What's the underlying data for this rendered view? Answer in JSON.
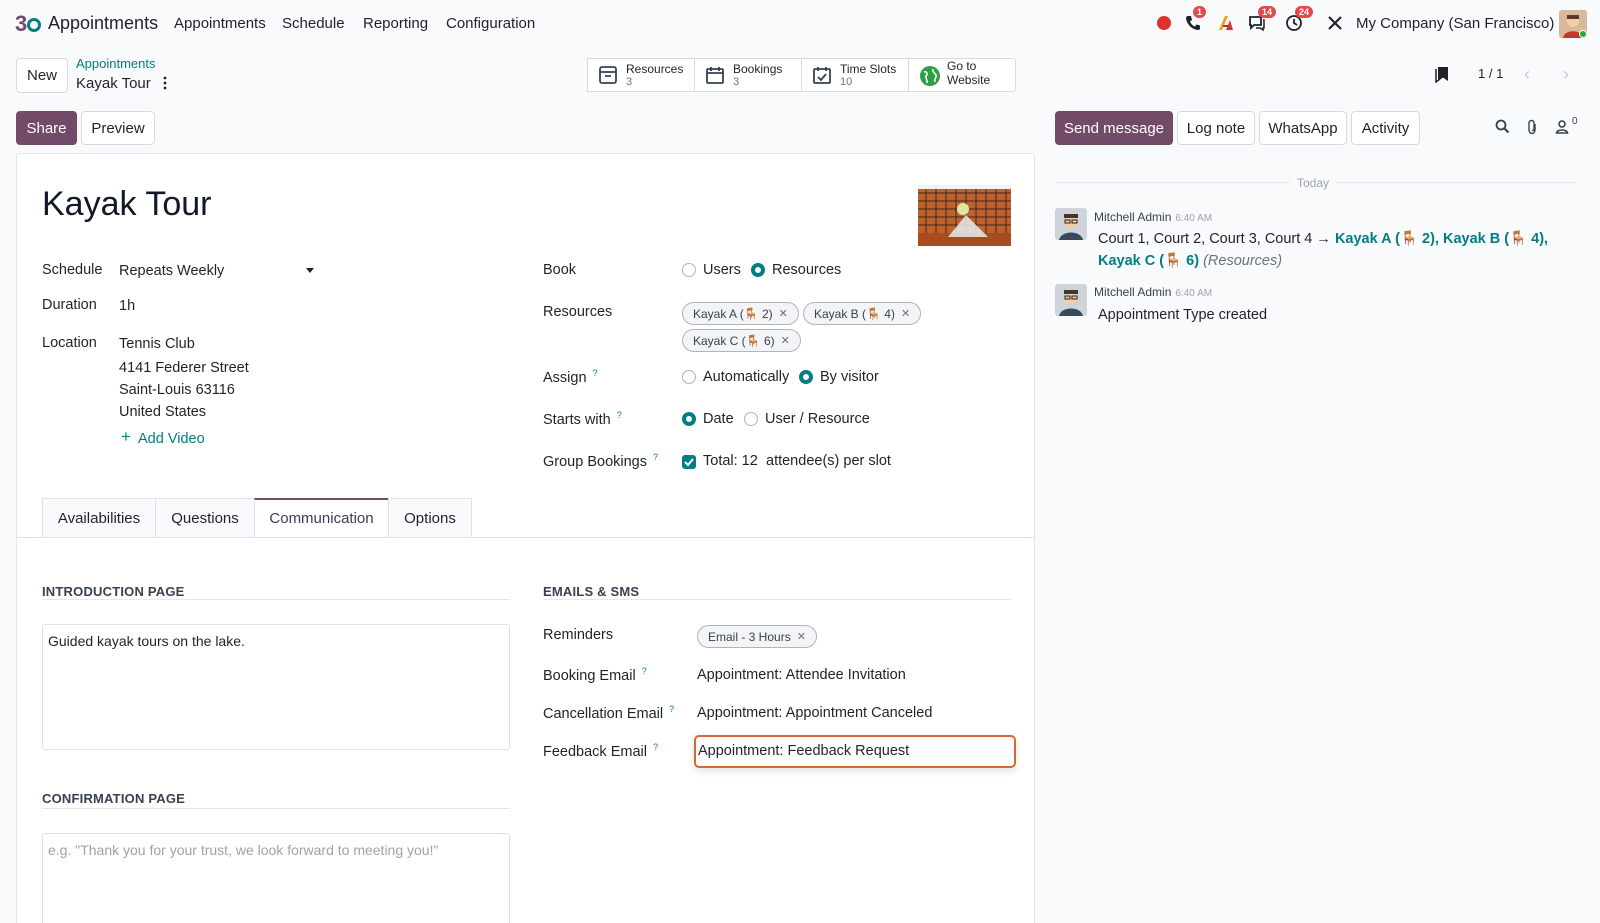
{
  "nav": {
    "app_name": "Appointments",
    "menu": [
      "Appointments",
      "Schedule",
      "Reporting",
      "Configuration"
    ],
    "badges": {
      "phone": "1",
      "chat": "14",
      "activity": "24"
    },
    "company": "My Company (San Francisco)"
  },
  "control": {
    "new_label": "New",
    "breadcrumb_parent": "Appointments",
    "breadcrumb_current": "Kayak Tour",
    "pager": "1 / 1",
    "smart_buttons": [
      {
        "label": "Resources",
        "count": "3",
        "icon": "resources-icon"
      },
      {
        "label": "Bookings",
        "count": "3",
        "icon": "calendar-icon"
      },
      {
        "label": "Time Slots",
        "count": "10",
        "icon": "calendar-check-icon"
      },
      {
        "label": "Go to",
        "count": "Website",
        "icon": "globe-icon"
      }
    ]
  },
  "actions": {
    "share": "Share",
    "preview": "Preview"
  },
  "form": {
    "title": "Kayak Tour",
    "schedule_label": "Schedule",
    "schedule_value": "Repeats Weekly",
    "duration_label": "Duration",
    "duration_value": "1h",
    "location_label": "Location",
    "location_lines": [
      "Tennis Club",
      "4141 Federer Street",
      "Saint-Louis 63116",
      "United States"
    ],
    "add_video": "Add Video",
    "book_label": "Book",
    "book_options": [
      "Users",
      "Resources"
    ],
    "resources_label": "Resources",
    "resources_tags": [
      "Kayak A (🪑 2)",
      "Kayak B (🪑 4)",
      "Kayak C (🪑 6)"
    ],
    "assign_label": "Assign",
    "assign_options": [
      "Automatically",
      "By visitor"
    ],
    "starts_label": "Starts with",
    "starts_options": [
      "Date",
      "User / Resource"
    ],
    "group_label": "Group Bookings",
    "group_total": "Total: 12",
    "group_suffix": "attendee(s) per slot"
  },
  "tabs": [
    "Availabilities",
    "Questions",
    "Communication",
    "Options"
  ],
  "communication": {
    "intro_title": "INTRODUCTION PAGE",
    "intro_text": "Guided kayak tours on the lake.",
    "confirm_title": "CONFIRMATION PAGE",
    "confirm_placeholder": "e.g. \"Thank you for your trust, we look forward to meeting you!\"",
    "emails_title": "EMAILS & SMS",
    "reminders_label": "Reminders",
    "reminder_tag": "Email - 3 Hours",
    "booking_email_label": "Booking Email",
    "booking_email_value": "Appointment: Attendee Invitation",
    "cancel_email_label": "Cancellation Email",
    "cancel_email_value": "Appointment: Appointment Canceled",
    "feedback_email_label": "Feedback Email",
    "feedback_email_value": "Appointment: Feedback Request"
  },
  "chatter": {
    "send_message": "Send message",
    "log_note": "Log note",
    "whatsapp": "WhatsApp",
    "activity": "Activity",
    "followers": "0",
    "day": "Today",
    "messages": [
      {
        "author": "Mitchell Admin",
        "time": "6:40 AM",
        "old": "Court 1, Court 2, Court 3, Court 4",
        "arrow": "→",
        "new": "Kayak A (🪑 2), Kayak B (🪑 4),",
        "new2": "Kayak C (🪑 6)",
        "field": "(Resources)"
      },
      {
        "author": "Mitchell Admin",
        "time": "6:40 AM",
        "body": "Appointment Type created"
      }
    ]
  },
  "colors": {
    "brand": "#714b67",
    "accent": "#017e84",
    "focus": "#d9653a"
  }
}
